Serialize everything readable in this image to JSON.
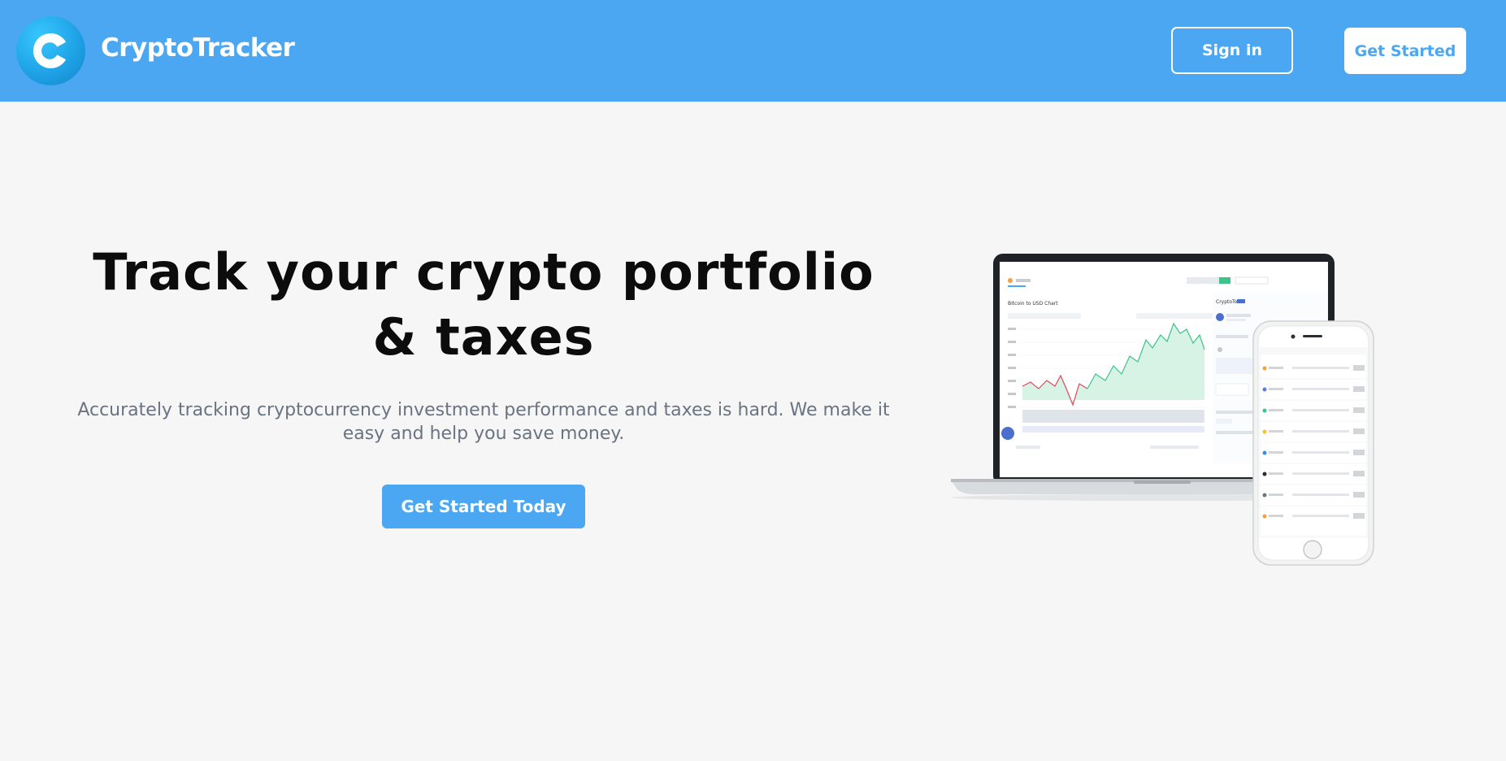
{
  "header": {
    "brand": "CryptoTracker",
    "signin_label": "Sign in",
    "get_started_label": "Get Started"
  },
  "hero": {
    "title": "Track your crypto portfolio & taxes",
    "subtitle": "Accurately tracking cryptocurrency investment performance and taxes is hard. We make it easy and help you save money.",
    "cta_label": "Get Started Today"
  },
  "illustration": {
    "laptop": {
      "chart_title": "Bitcoin to USD Chart",
      "side_title": "CryptoTown"
    }
  },
  "colors": {
    "brand_blue": "#4ba7f2",
    "background": "#f6f6f6",
    "title": "#0c0c0c",
    "subtitle": "#6a7381",
    "chart_green": "#3cc48a",
    "chart_red": "#e0455c"
  },
  "icons": {
    "logo": "cryptotracker-logo-icon"
  }
}
